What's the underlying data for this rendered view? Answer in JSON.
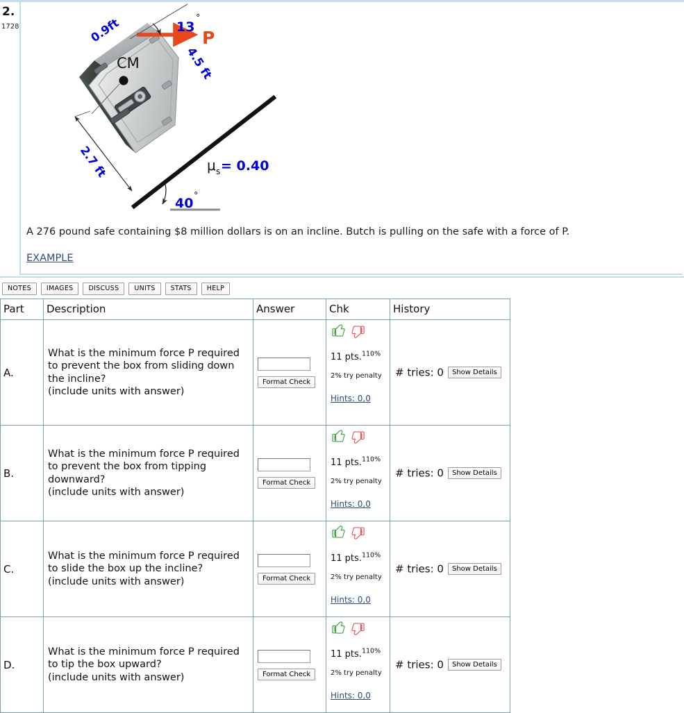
{
  "problem": {
    "number": "2.",
    "id": "1728",
    "statement": "A 276 pound safe containing $8 million dollars is on an incline. Butch is pulling on the safe with a force of P.",
    "example_link": "EXAMPLE"
  },
  "figure": {
    "alt": "safe-on-incline-diagram",
    "labels": {
      "top_width": "0.9ft",
      "side_length": "4.5 ft",
      "bottom_width": "2.7 ft",
      "force_angle": "13",
      "force_angle_unit": "°",
      "force_name": "P",
      "cm_label": "CM",
      "friction_symbol": "μ",
      "friction_subscript": "s",
      "friction_value": "= 0.40",
      "incline_angle": "40",
      "incline_angle_unit": "°"
    },
    "colors": {
      "label_blue": "#0000d8",
      "force_orange": "#e8481c",
      "incline_black": "#111111"
    }
  },
  "toolbar": {
    "buttons": [
      {
        "label": "NOTES",
        "name": "notes-button"
      },
      {
        "label": "IMAGES",
        "name": "images-button"
      },
      {
        "label": "DISCUSS",
        "name": "discuss-button"
      },
      {
        "label": "UNITS",
        "name": "units-button"
      },
      {
        "label": "STATS",
        "name": "stats-button"
      },
      {
        "label": "HELP",
        "name": "help-button"
      }
    ]
  },
  "table": {
    "headers": {
      "part": "Part",
      "description": "Description",
      "answer": "Answer",
      "chk": "Chk",
      "history": "History"
    },
    "common": {
      "answer_value": "",
      "answer_placeholder": "",
      "format_check_label": "Format Check",
      "points_label": "11 pts.",
      "points_percent": "110%",
      "penalty_label": "2% try penalty",
      "hints_label": "Hints: 0,0",
      "tries_label": "# tries: 0",
      "show_details_label": "Show Details",
      "thumbs_up_icon": "thumbs-up-icon",
      "thumbs_down_icon": "thumbs-down-icon"
    },
    "rows": [
      {
        "part": "A.",
        "description": "What is the minimum force P required to prevent the box from sliding down the incline?\n(include units with answer)"
      },
      {
        "part": "B.",
        "description": "What is the minimum force P required to prevent the box from tipping downward?\n(include units with answer)"
      },
      {
        "part": "C.",
        "description": "What is the minimum force P required to slide the box up the incline?\n(include units with answer)"
      },
      {
        "part": "D.",
        "description": "What is the minimum force P required to tip the box upward?\n(include units with answer)"
      }
    ]
  }
}
